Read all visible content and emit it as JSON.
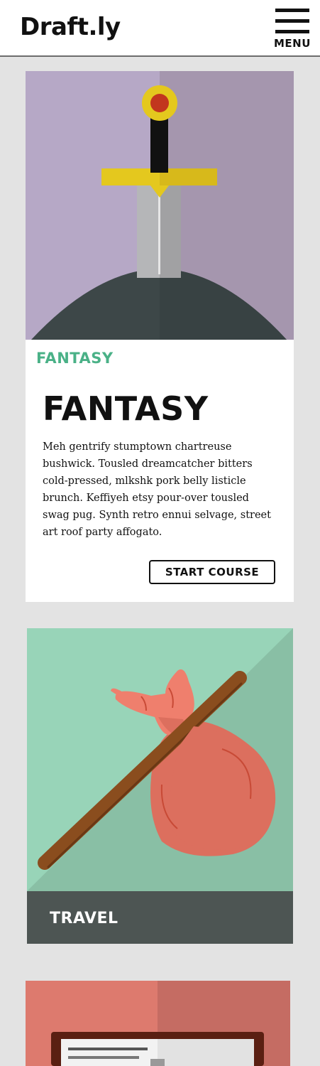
{
  "header": {
    "logo": "Draft.ly",
    "menu_label": "MENU"
  },
  "cards": [
    {
      "category": "FANTASY",
      "title": "FANTASY",
      "description": "Meh gentrify stumptown chartreuse bushwick. Tousled dreamcatcher bitters cold-pressed, mlkshk pork belly listicle brunch. Keffiyeh etsy pour-over tousled swag pug. Synth retro ennui selvage, street art roof party affogato.",
      "button_label": "START COURSE",
      "art_icon": "sword-in-stone-icon"
    },
    {
      "category": "TRAVEL",
      "art_icon": "bindle-icon"
    },
    {
      "art_icon": "book-icon"
    }
  ],
  "colors": {
    "accent": "#4ab187",
    "fantasy_bg": "#b6a8c6",
    "travel_bg": "#98d4b8",
    "travel_bar": "#4d5553",
    "third_bg": "#dd7a6e"
  }
}
